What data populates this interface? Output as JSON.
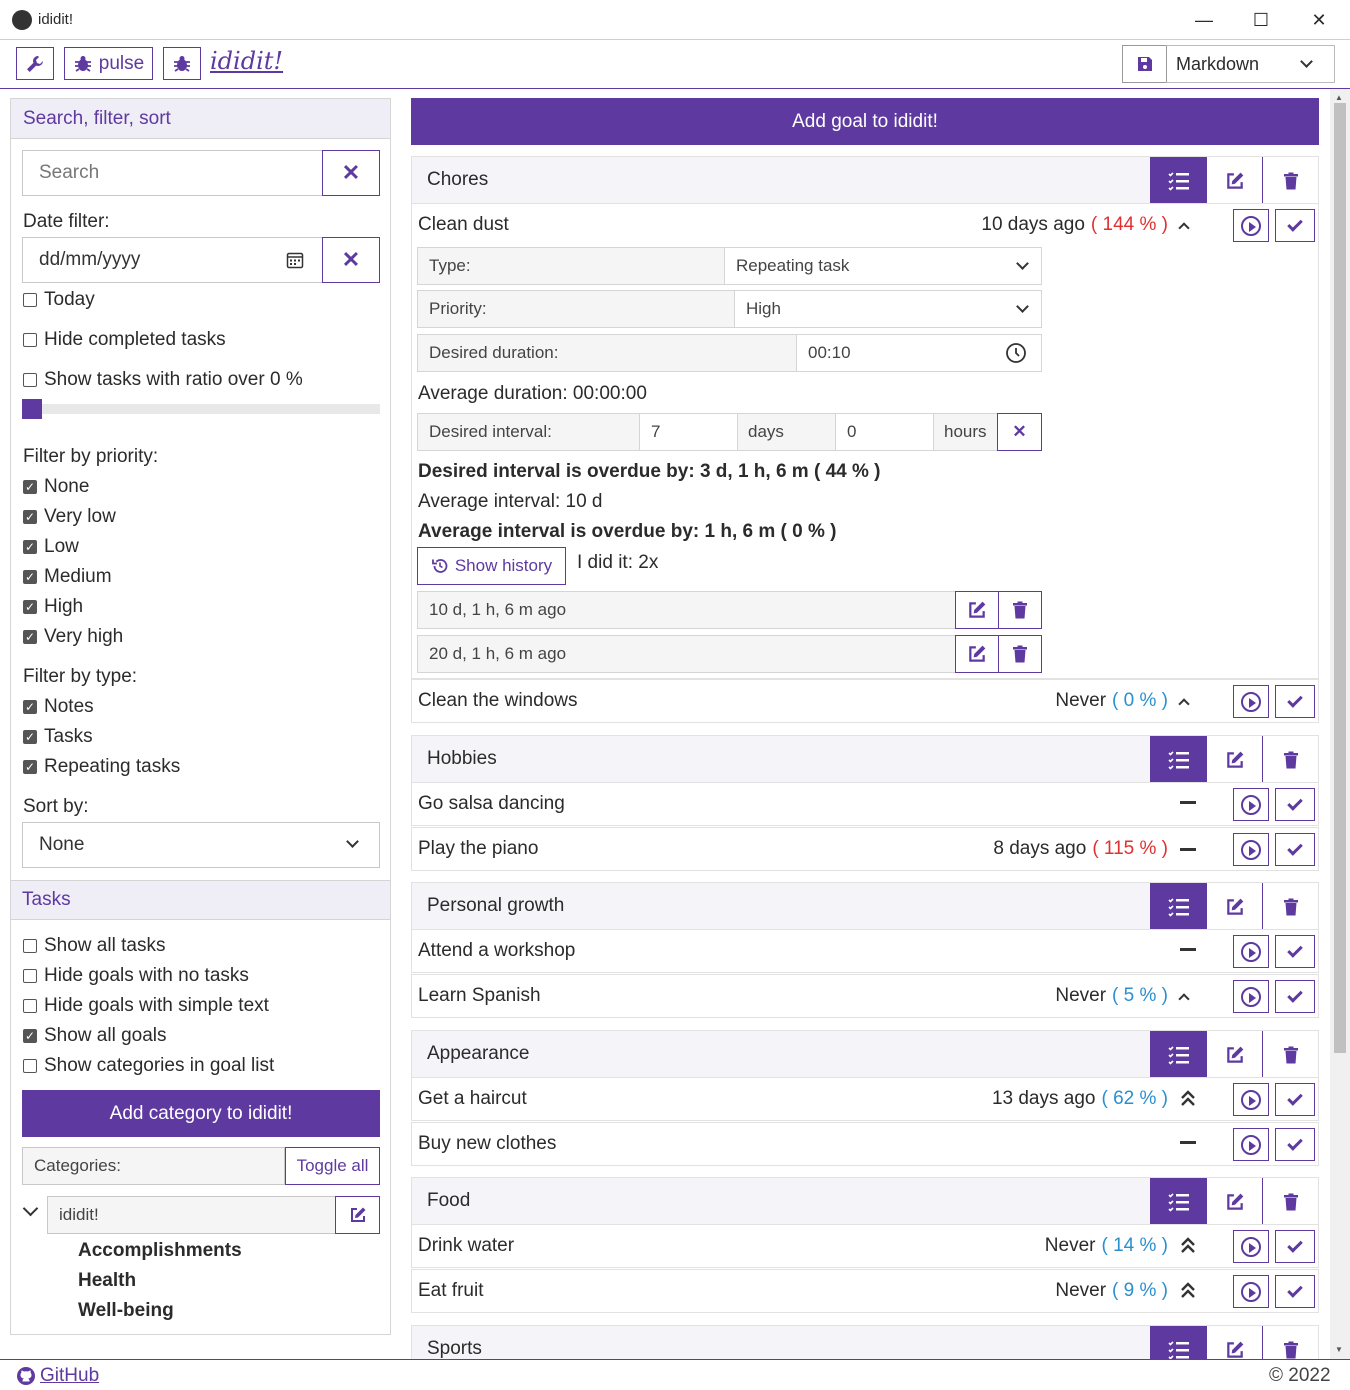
{
  "window": {
    "title": "ididit!",
    "minimize": "—",
    "maximize": "☐",
    "close": "✕"
  },
  "toolbar": {
    "pulse_label": "pulse",
    "logo": "ididit!",
    "format_value": "Markdown"
  },
  "sidebar": {
    "search_header": "Search, filter, sort",
    "search_placeholder": "Search",
    "date_filter_label": "Date filter:",
    "date_placeholder": "dd/mm/yyyy",
    "today_label": "Today",
    "hide_completed_label": "Hide completed tasks",
    "ratio_label": "Show tasks with ratio over 0 %",
    "ratio_value": 0,
    "priority_label": "Filter by priority:",
    "priorities": [
      {
        "label": "None",
        "checked": true
      },
      {
        "label": "Very low",
        "checked": true
      },
      {
        "label": "Low",
        "checked": true
      },
      {
        "label": "Medium",
        "checked": true
      },
      {
        "label": "High",
        "checked": true
      },
      {
        "label": "Very high",
        "checked": true
      }
    ],
    "type_label": "Filter by type:",
    "types": [
      {
        "label": "Notes",
        "checked": true
      },
      {
        "label": "Tasks",
        "checked": true
      },
      {
        "label": "Repeating tasks",
        "checked": true
      }
    ],
    "sort_label": "Sort by:",
    "sort_value": "None",
    "tasks_header": "Tasks",
    "task_options": [
      {
        "label": "Show all tasks",
        "checked": false
      },
      {
        "label": "Hide goals with no tasks",
        "checked": false
      },
      {
        "label": "Hide goals with simple text",
        "checked": false
      },
      {
        "label": "Show all goals",
        "checked": true
      },
      {
        "label": "Show categories in goal list",
        "checked": false
      }
    ],
    "add_category_label": "Add category to ididit!",
    "categories_label": "Categories:",
    "toggle_all_label": "Toggle all",
    "tree_root": "ididit!",
    "tree_children": [
      "Accomplishments",
      "Health",
      "Well-being"
    ]
  },
  "main": {
    "add_goal_label": "Add goal to ididit!",
    "categories": [
      {
        "name": "Chores"
      },
      {
        "name": "Hobbies"
      },
      {
        "name": "Personal growth"
      },
      {
        "name": "Appearance"
      },
      {
        "name": "Food"
      },
      {
        "name": "Sports"
      }
    ],
    "goals": [
      {
        "name": "Clean dust",
        "when": "10 days ago",
        "ratio": "( 144 % )",
        "ratio_color": "#e03030",
        "priority_icon": "chevron-up-icon"
      },
      {
        "name": "Clean the windows",
        "when": "Never",
        "ratio": "( 0 % )",
        "ratio_color": "#2a8fd0",
        "priority_icon": "chevron-up-icon"
      },
      {
        "name": "Go salsa dancing",
        "when": "",
        "ratio": "",
        "priority_icon": "dash-icon"
      },
      {
        "name": "Play the piano",
        "when": "8 days ago",
        "ratio": "( 115 % )",
        "ratio_color": "#e03030",
        "priority_icon": "dash-icon"
      },
      {
        "name": "Attend a workshop",
        "when": "",
        "ratio": "",
        "priority_icon": "dash-icon"
      },
      {
        "name": "Learn Spanish",
        "when": "Never",
        "ratio": "( 5 % )",
        "ratio_color": "#2a8fd0",
        "priority_icon": "chevron-up-icon"
      },
      {
        "name": "Get a haircut",
        "when": "13 days ago",
        "ratio": "( 62 % )",
        "ratio_color": "#2a8fd0",
        "priority_icon": "double-chevron-up-icon"
      },
      {
        "name": "Buy new clothes",
        "when": "",
        "ratio": "",
        "priority_icon": "dash-icon"
      },
      {
        "name": "Drink water",
        "when": "Never",
        "ratio": "( 14 % )",
        "ratio_color": "#2a8fd0",
        "priority_icon": "double-chevron-up-icon"
      },
      {
        "name": "Eat fruit",
        "when": "Never",
        "ratio": "( 9 % )",
        "ratio_color": "#2a8fd0",
        "priority_icon": "double-chevron-up-icon"
      }
    ],
    "detail": {
      "type_label": "Type:",
      "type_value": "Repeating task",
      "priority_label": "Priority:",
      "priority_value": "High",
      "duration_label": "Desired duration:",
      "duration_value": "00:10",
      "avg_duration": "Average duration: 00:00:00",
      "interval_label": "Desired interval:",
      "interval_days": "7",
      "days_label": "days",
      "interval_hours": "0",
      "hours_label": "hours",
      "overdue_desired": "Desired interval is overdue by: 3 d, 1 h, 6 m ( 44 % )",
      "avg_interval": "Average interval: 10 d",
      "overdue_avg": "Average interval is overdue by: 1 h, 6 m ( 0 % )",
      "show_history_label": "Show history",
      "did_it": "I did it: 2x",
      "history": [
        "10 d, 1 h, 6 m ago",
        "20 d, 1 h, 6 m ago"
      ]
    }
  },
  "footer": {
    "github": "GitHub",
    "copyright": "© 2022"
  },
  "colors": {
    "accent": "#5e3aa0",
    "overdue": "#e03030",
    "ok": "#2a8fd0"
  }
}
